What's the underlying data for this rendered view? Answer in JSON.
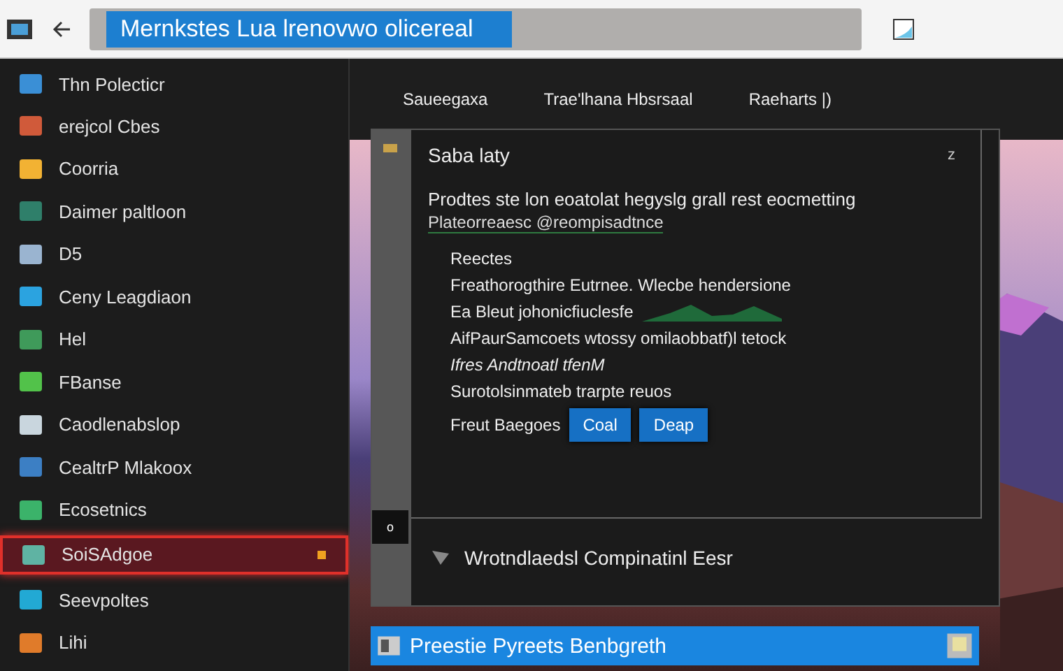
{
  "toolbar": {
    "address": "Mernkstes Lua lrenovwo olicereal"
  },
  "sidebar": {
    "items": [
      {
        "label": "Thn Polecticr",
        "selected": false,
        "color": "#3a8fd6"
      },
      {
        "label": "erejcol Cbes",
        "selected": false,
        "color": "#d05a3a"
      },
      {
        "label": "Coorria",
        "selected": false,
        "color": "#f2b233"
      },
      {
        "label": "Daimer paltloon",
        "selected": false,
        "color": "#2f7f6a"
      },
      {
        "label": "D5",
        "selected": false,
        "color": "#9ab4d0"
      },
      {
        "label": "Ceny Leagdiaon",
        "selected": false,
        "color": "#2ba3e0"
      },
      {
        "label": "Hel",
        "selected": false,
        "color": "#3f9a5a"
      },
      {
        "label": "FBanse",
        "selected": false,
        "color": "#52c24a"
      },
      {
        "label": "Caodlenabslop",
        "selected": false,
        "color": "#c9d6de"
      },
      {
        "label": "CealtrP Mlakoox",
        "selected": false,
        "color": "#3c7fc4"
      },
      {
        "label": "Ecosetnics",
        "selected": false,
        "color": "#3bb36a"
      },
      {
        "label": "SoiSAdgoe",
        "selected": true,
        "color": "#5fb3a3"
      },
      {
        "label": "Seevpoltes",
        "selected": false,
        "color": "#22a9d4"
      },
      {
        "label": "Lihi",
        "selected": false,
        "color": "#e07b2a"
      }
    ]
  },
  "tabs": [
    "Saueegaxa",
    "Trae'lhana Hbsrsaal",
    "Raeharts |)"
  ],
  "dialog": {
    "title": "Saba laty",
    "close": "z",
    "intro": "Prodtes ste lon eoatolat hegyslg grall rest eocmetting",
    "link": "Plateorreaesc @reompisadtnce",
    "lines": [
      {
        "kind": "text",
        "text": "Reectes"
      },
      {
        "kind": "text",
        "text": "Freathorogthire Eutrnee. Wlecbe hendersione"
      },
      {
        "kind": "spark",
        "text": "Ea Bleut johonicfiuclesfe"
      },
      {
        "kind": "text",
        "text": "AifPaurSamcoets wtossy omilaobbatf)l tetock"
      },
      {
        "kind": "italic",
        "text": "Ifres Andtnoatl tfenM"
      },
      {
        "kind": "text",
        "text": "Surotolsinmateb trarpte reuos"
      }
    ],
    "action_label": "Freut Baegoes",
    "buttons": [
      "Coal",
      "Deap"
    ],
    "gutter_mark": "o",
    "footer": "Wrotndlaedsl Compinatinl Eesr"
  },
  "status_bar": {
    "text": "Preestie Pyreets Benbgreth"
  }
}
